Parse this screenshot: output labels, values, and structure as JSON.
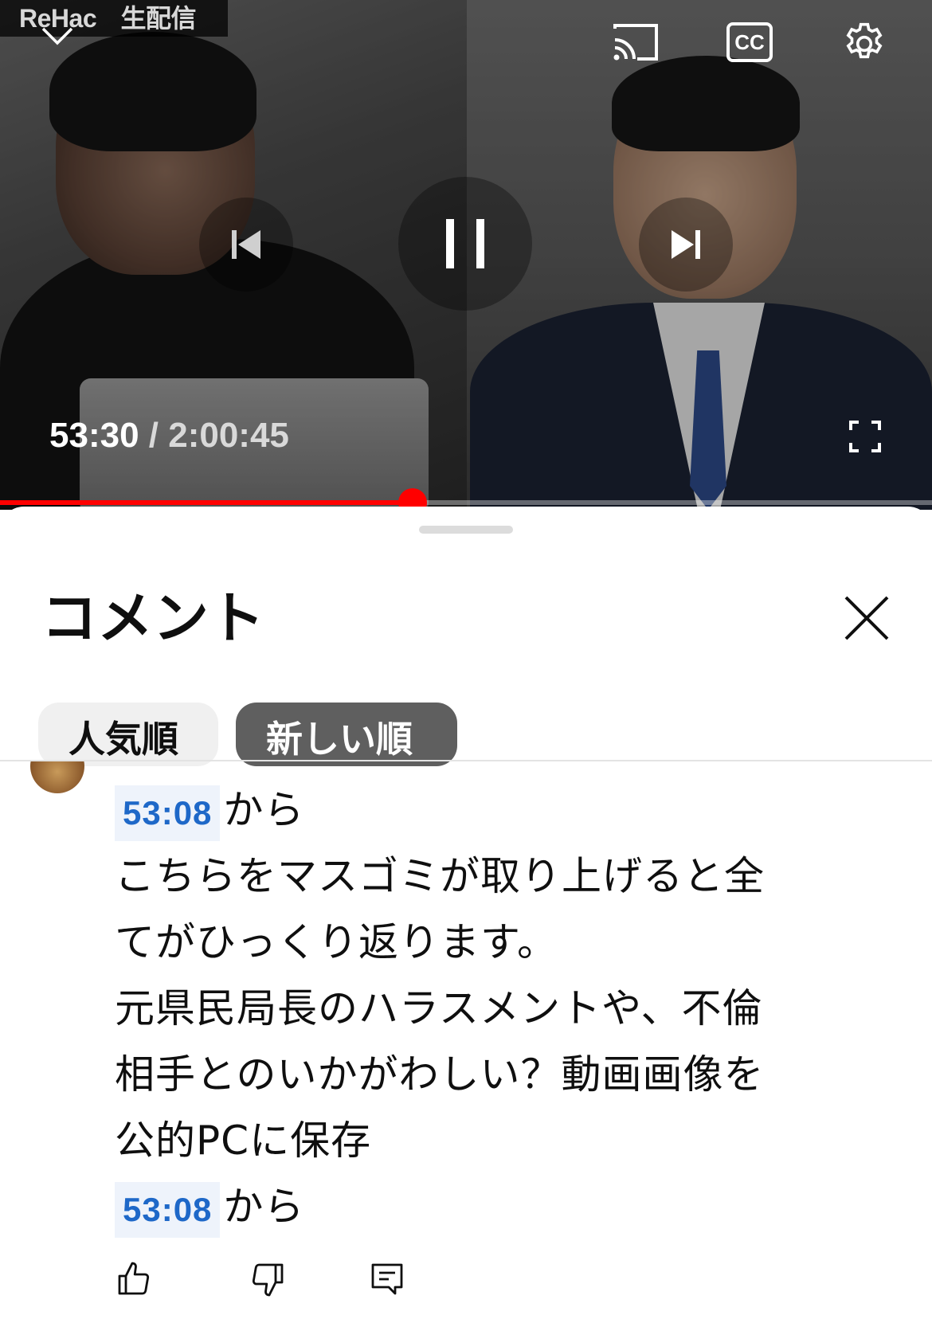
{
  "player": {
    "channel_logo": "ReHac",
    "channel_badge": "生配信",
    "current_time": "53:30",
    "separator": " / ",
    "total_time": "2:00:45",
    "progress_fraction": 0.4424
  },
  "icons": {
    "minimize": "chevron-down-icon",
    "cast": "cast-icon",
    "captions": "closed-captions-icon",
    "settings": "gear-icon",
    "previous": "skip-previous-icon",
    "pause": "pause-icon",
    "next": "skip-next-icon",
    "fullscreen": "fullscreen-icon",
    "close": "close-icon",
    "like": "thumbs-up-icon",
    "dislike": "thumbs-down-icon",
    "reply": "reply-icon"
  },
  "captions_label": "CC",
  "sheet": {
    "title": "コメント",
    "sort_chips": [
      {
        "label": "人気順",
        "selected": false
      },
      {
        "label": "新しい順",
        "selected": true
      }
    ]
  },
  "comment": {
    "timestamp_1": "53:08",
    "suffix_1": "から",
    "lines": [
      "こちらをマスゴミが取り上げると全",
      "てがひっくり返ります。",
      "元県民局長のハラスメントや、不倫",
      "相手とのいかがわしい？動画画像を",
      "公的PCに保存"
    ],
    "timestamp_2": "53:08",
    "suffix_2": "から"
  },
  "colors": {
    "progress": "#ff0000",
    "timestamp_link": "#1e68c8",
    "selected_chip": "#5f5f5f"
  }
}
